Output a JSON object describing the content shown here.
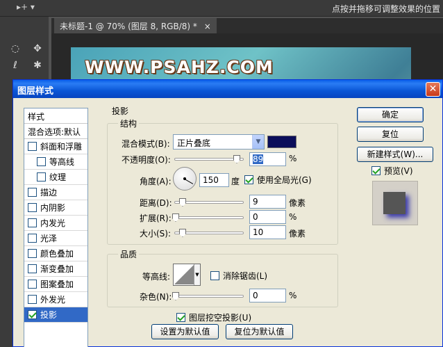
{
  "ps": {
    "move_tool_glyph": "▸+ ▾",
    "hint": "点按并拖移可调整效果的位置",
    "document_tab": "未标题-1 @ 70% (图层 8, RGB/8) *",
    "tab_close": "×",
    "canvas_title": "WWW.PSAHZ.COM"
  },
  "dialog": {
    "title": "图层样式",
    "close": "✕",
    "styles_header": "样式",
    "blend_options": "混合选项:默认",
    "styles": [
      {
        "label": "斜面和浮雕",
        "checked": false,
        "sub": false
      },
      {
        "label": "等高线",
        "checked": false,
        "sub": true
      },
      {
        "label": "纹理",
        "checked": false,
        "sub": true
      },
      {
        "label": "描边",
        "checked": false,
        "sub": false
      },
      {
        "label": "内阴影",
        "checked": false,
        "sub": false
      },
      {
        "label": "内发光",
        "checked": false,
        "sub": false
      },
      {
        "label": "光泽",
        "checked": false,
        "sub": false
      },
      {
        "label": "颜色叠加",
        "checked": false,
        "sub": false
      },
      {
        "label": "渐变叠加",
        "checked": false,
        "sub": false
      },
      {
        "label": "图案叠加",
        "checked": false,
        "sub": false
      },
      {
        "label": "外发光",
        "checked": false,
        "sub": false
      },
      {
        "label": "投影",
        "checked": true,
        "sub": false,
        "selected": true
      }
    ],
    "section_title": "投影",
    "structure": {
      "title": "结构",
      "blend_mode_label": "混合模式(B):",
      "blend_mode_value": "正片叠底",
      "shadow_color": "#0b0e5a",
      "opacity_label": "不透明度(O):",
      "opacity_value": "89",
      "opacity_unit": "%",
      "angle_label": "角度(A):",
      "angle_value": "150",
      "angle_unit": "度",
      "global_light_label": "使用全局光(G)",
      "global_light_checked": true,
      "distance_label": "距离(D):",
      "distance_value": "9",
      "distance_unit": "像素",
      "spread_label": "扩展(R):",
      "spread_value": "0",
      "spread_unit": "%",
      "size_label": "大小(S):",
      "size_value": "10",
      "size_unit": "像素"
    },
    "quality": {
      "title": "品质",
      "contour_label": "等高线:",
      "antialias_label": "消除锯齿(L)",
      "antialias_checked": false,
      "noise_label": "杂色(N):",
      "noise_value": "0",
      "noise_unit": "%"
    },
    "knockout_label": "图层挖空投影(U)",
    "knockout_checked": true,
    "make_default": "设置为默认值",
    "reset_default": "复位为默认值",
    "buttons": {
      "ok": "确定",
      "reset": "复位",
      "new_style": "新建样式(W)...",
      "preview": "预览(V)",
      "preview_checked": true
    },
    "preview_swatch_color": "#555555"
  }
}
